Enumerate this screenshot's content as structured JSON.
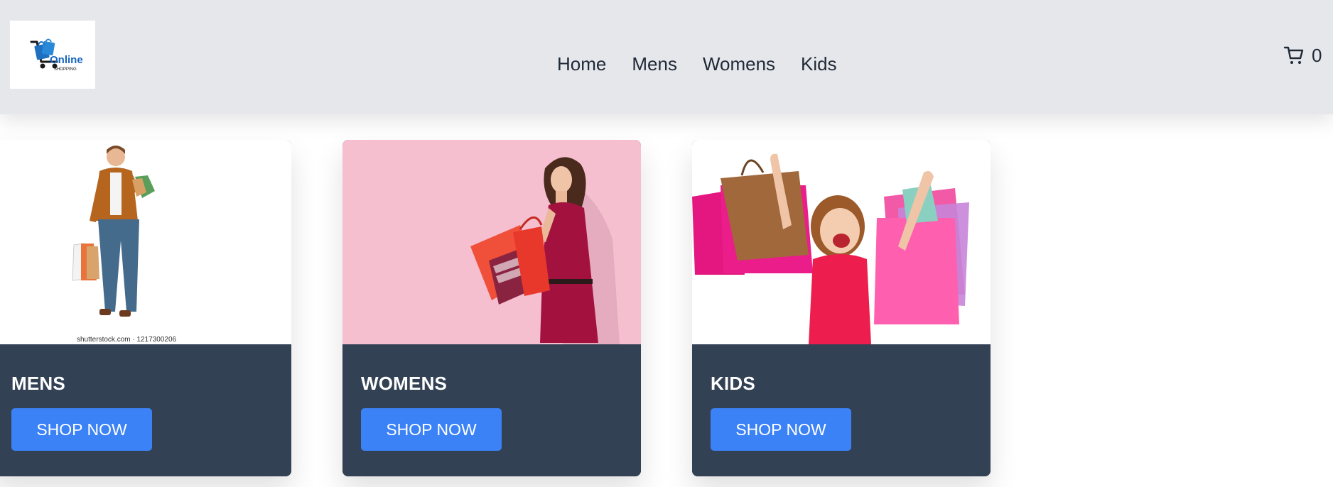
{
  "brand": {
    "logo_word": "Online",
    "logo_sub": "SHOPPING"
  },
  "nav": {
    "links": [
      "Home",
      "Mens",
      "Womens",
      "Kids"
    ]
  },
  "cart": {
    "icon": "cart-icon",
    "count": "0"
  },
  "cards": [
    {
      "title": "MENS",
      "button": "SHOP NOW",
      "image_bg": "#ffffff",
      "watermark": "shutterstock.com · 1217300206"
    },
    {
      "title": "WOMENS",
      "button": "SHOP NOW",
      "image_bg": "#f5bfd0"
    },
    {
      "title": "KIDS",
      "button": "SHOP NOW",
      "image_bg": "#ffffff"
    }
  ],
  "colors": {
    "navbar_bg": "#e5e7eb",
    "card_footer": "#334155",
    "button": "#3b82f6",
    "womens_bg": "#f5bfd0"
  }
}
